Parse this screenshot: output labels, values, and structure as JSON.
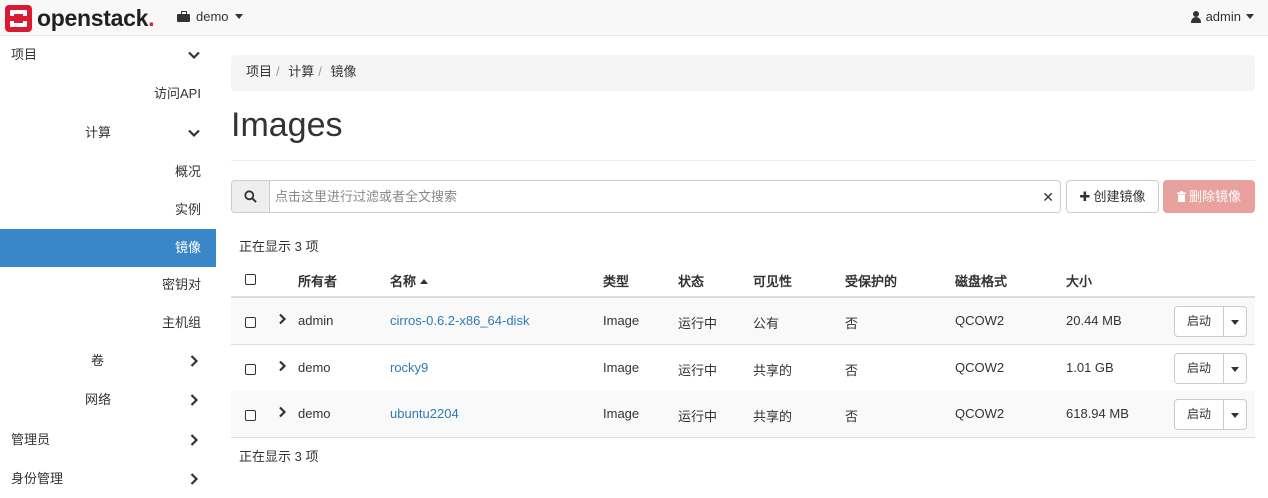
{
  "topbar": {
    "brand": "openstack",
    "brand_dot": ".",
    "project": "demo",
    "user": "admin"
  },
  "sidebar": {
    "items": [
      {
        "label": "项目",
        "icon": "chevron-down-icon"
      },
      {
        "label": "访问API"
      },
      {
        "label": "计算",
        "icon": "chevron-down-icon"
      },
      {
        "label": "概况"
      },
      {
        "label": "实例"
      },
      {
        "label": "镜像",
        "active": true
      },
      {
        "label": "密钥对"
      },
      {
        "label": "主机组"
      },
      {
        "label": "卷",
        "icon": "chevron-right-icon"
      },
      {
        "label": "网络",
        "icon": "chevron-right-icon"
      },
      {
        "label": "管理员",
        "icon": "chevron-right-icon"
      },
      {
        "label": "身份管理",
        "icon": "chevron-right-icon"
      }
    ]
  },
  "breadcrumb": [
    "项目",
    "计算",
    "镜像"
  ],
  "page_title": "Images",
  "search": {
    "placeholder": "点击这里进行过滤或者全文搜索",
    "value": ""
  },
  "actions": {
    "create": "创建镜像",
    "delete": "删除镜像"
  },
  "count_text": "正在显示 3 项",
  "table": {
    "columns": [
      "所有者",
      "名称",
      "类型",
      "状态",
      "可见性",
      "受保护的",
      "磁盘格式",
      "大小"
    ],
    "rows": [
      {
        "owner": "admin",
        "name": "cirros-0.6.2-x86_64-disk",
        "type": "Image",
        "status": "运行中",
        "visibility": "公有",
        "protected": "否",
        "format": "QCOW2",
        "size": "20.44 MB",
        "action": "启动"
      },
      {
        "owner": "demo",
        "name": "rocky9",
        "type": "Image",
        "status": "运行中",
        "visibility": "共享的",
        "protected": "否",
        "format": "QCOW2",
        "size": "1.01 GB",
        "action": "启动"
      },
      {
        "owner": "demo",
        "name": "ubuntu2204",
        "type": "Image",
        "status": "运行中",
        "visibility": "共享的",
        "protected": "否",
        "format": "QCOW2",
        "size": "618.94 MB",
        "action": "启动"
      }
    ]
  },
  "colors": {
    "brand_red": "#da1a32",
    "active_bg": "#3a87c8",
    "link": "#2c7bb6",
    "delete_btn": "#e8a19d"
  }
}
